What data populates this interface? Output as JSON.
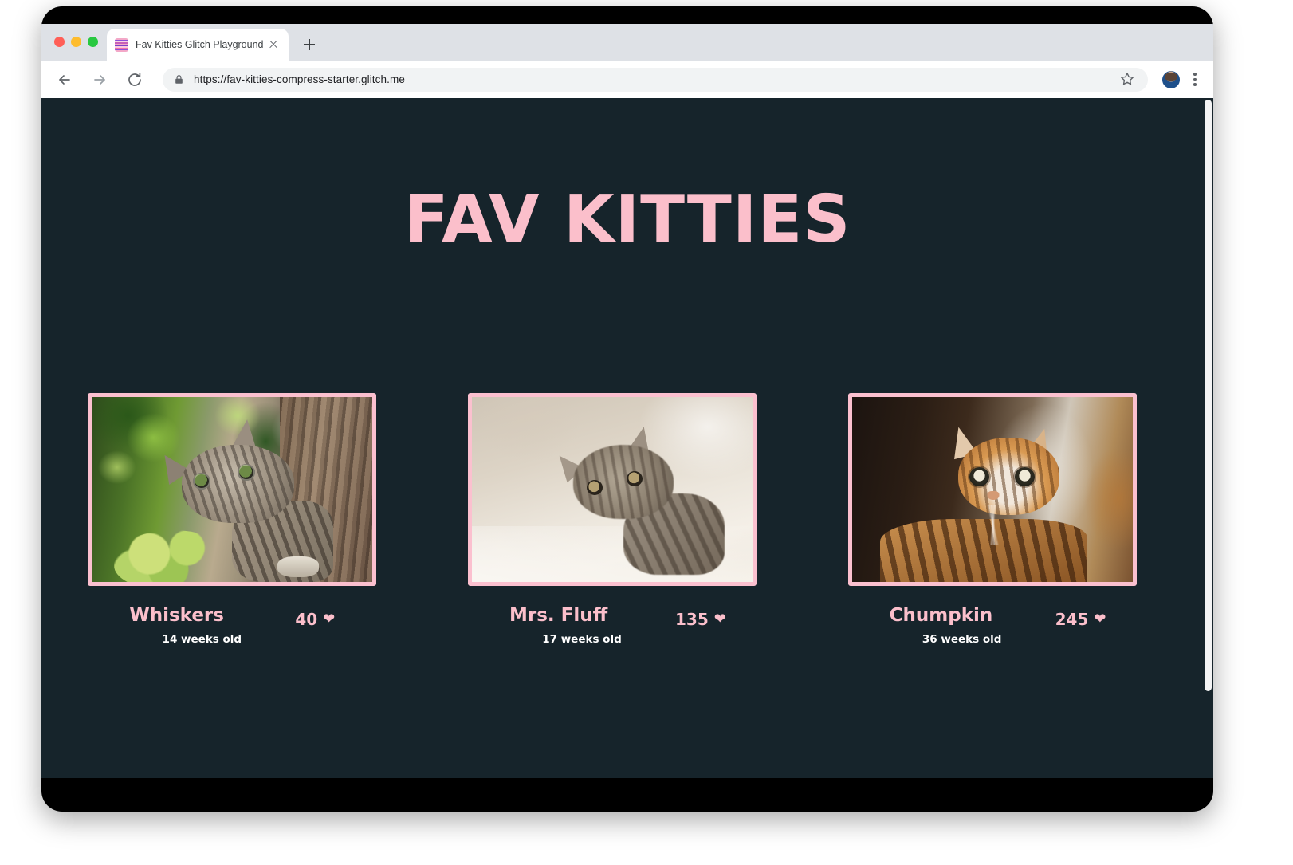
{
  "browser": {
    "tab": {
      "title": "Fav Kitties Glitch Playground",
      "favicon_name": "glitch-logo-icon",
      "close_label": "×"
    },
    "new_tab_label": "+",
    "nav": {
      "back_label": "Back",
      "forward_label": "Forward",
      "reload_label": "Reload"
    },
    "omnibox": {
      "url": "https://fav-kitties-compress-starter.glitch.me",
      "lock_icon": "lock-icon",
      "star_icon": "bookmark-star-icon"
    },
    "profile_icon": "profile-avatar-icon",
    "menu_icon": "three-dot-menu-icon"
  },
  "page": {
    "title": "FAV KITTIES",
    "colors": {
      "background": "#16242b",
      "accent_pink": "#fbbfcb",
      "border_pink": "#fbc0cf",
      "text_white": "#ffffff"
    },
    "heart_glyph": "❤",
    "cards": [
      {
        "name": "Whiskers",
        "age": "14 weeks old",
        "likes": "40",
        "photo_name": "kitten-photo-whiskers",
        "photo_alt": "Grey tabby kitten climbing a tree among green leaves"
      },
      {
        "name": "Mrs. Fluff",
        "age": "17 weeks old",
        "likes": "135",
        "photo_name": "kitten-photo-mrs-fluff",
        "photo_alt": "Fluffy grey kitten lying on a pale bed sheet"
      },
      {
        "name": "Chumpkin",
        "age": "36 weeks old",
        "likes": "245",
        "photo_name": "kitten-photo-chumpkin",
        "photo_alt": "Orange tabby cat with wide eyes looking upward"
      }
    ]
  }
}
